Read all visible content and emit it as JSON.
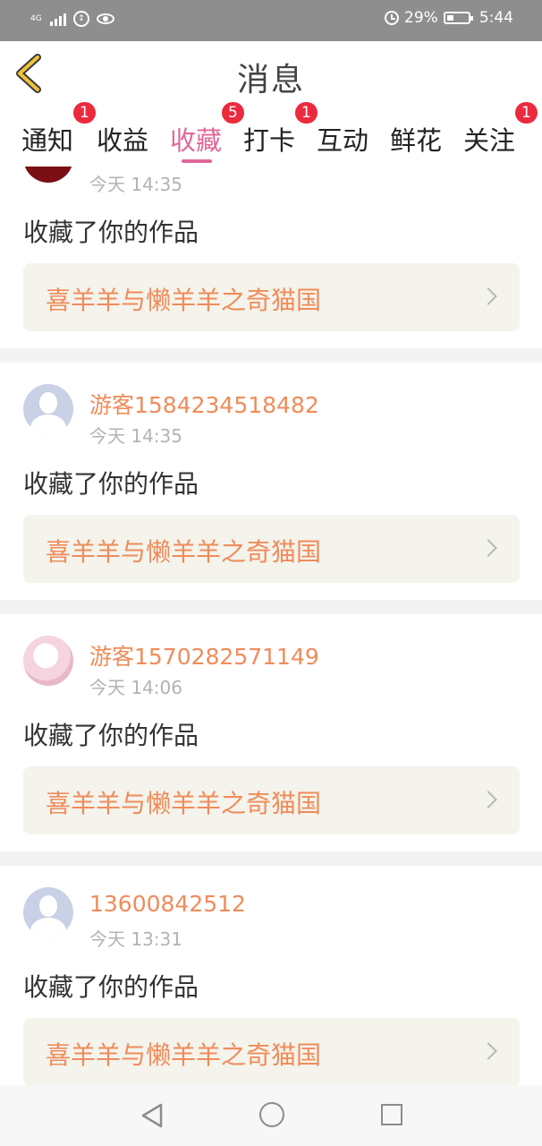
{
  "status_bar": {
    "network_label": "4G",
    "battery": "29%",
    "time": "5:44"
  },
  "header": {
    "title": "消息"
  },
  "tabs": [
    {
      "label": "通知",
      "badge": "1"
    },
    {
      "label": "收益",
      "badge": ""
    },
    {
      "label": "收藏",
      "badge": "5",
      "active": true
    },
    {
      "label": "打卡",
      "badge": "1"
    },
    {
      "label": "互动",
      "badge": ""
    },
    {
      "label": "鲜花",
      "badge": ""
    },
    {
      "label": "关注",
      "badge": "1"
    }
  ],
  "feed": [
    {
      "username": "",
      "time": "今天 14:35",
      "action": "收藏了你的作品",
      "work": "喜羊羊与懒羊羊之奇猫国",
      "avatar": "red-photo"
    },
    {
      "username": "游客1584234518482",
      "time": "今天 14:35",
      "action": "收藏了你的作品",
      "work": "喜羊羊与懒羊羊之奇猫国",
      "avatar": "default"
    },
    {
      "username": "游客1570282571149",
      "time": "今天 14:06",
      "action": "收藏了你的作品",
      "work": "喜羊羊与懒羊羊之奇猫国",
      "avatar": "photo"
    },
    {
      "username": "13600842512",
      "time": "今天 13:31",
      "action": "收藏了你的作品",
      "work": "喜羊羊与懒羊羊之奇猫国",
      "avatar": "default"
    }
  ],
  "colors": {
    "accent": "#e0679a",
    "username": "#ef8c5a",
    "badge": "#ec2a3e",
    "status_bar": "#8e8e8e"
  }
}
